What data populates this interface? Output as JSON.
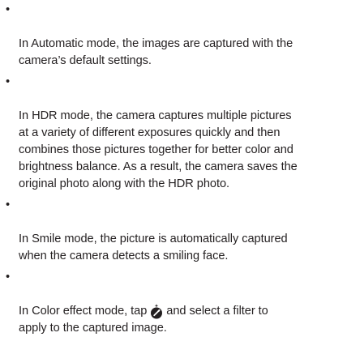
{
  "bullet_char": "•",
  "items": [
    {
      "lines": "In Automatic mode, the images are captured with the\ncamera’s default settings."
    },
    {
      "lines": "In HDR mode, the camera captures multiple pictures\nat a variety of different exposures quickly and then\ncombines those pictures together for better color and\nbrightness balance. As a result, the camera saves the\noriginal photo along with the HDR photo."
    },
    {
      "lines": "In Smile mode, the picture is automatically captured\nwhen the camera detects a smiling face."
    },
    {
      "before_icon": "In Color effect mode, tap ",
      "icon": "color-effect-icon",
      "after_icon": " and select a filter to\napply to the captured image."
    }
  ]
}
